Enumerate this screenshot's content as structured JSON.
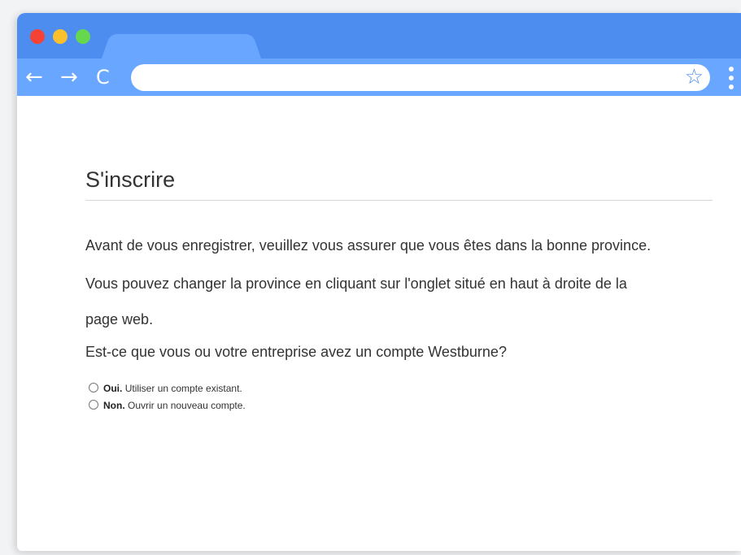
{
  "browser": {
    "nav": {
      "back": "←",
      "forward": "→",
      "reload": "C"
    },
    "address_bar": {
      "value": ""
    },
    "bookmark_icon": "star-outline",
    "accent_color": "#4d8df0",
    "toolbar_color": "#69a6ff"
  },
  "page": {
    "title": "S'inscrire",
    "paragraphs": [
      "Avant de vous enregistrer, veuillez vous assurer que vous êtes dans la bonne province.",
      "Vous pouvez changer la province en cliquant sur l'onglet situé en haut à droite de la",
      "page web.",
      "Est-ce que vous ou votre entreprise avez un compte Westburne?"
    ],
    "options": [
      {
        "label": "Oui.",
        "description": "Utiliser un compte existant.",
        "selected": false
      },
      {
        "label": "Non.",
        "description": "Ouvrir un nouveau compte.",
        "selected": false
      }
    ]
  }
}
